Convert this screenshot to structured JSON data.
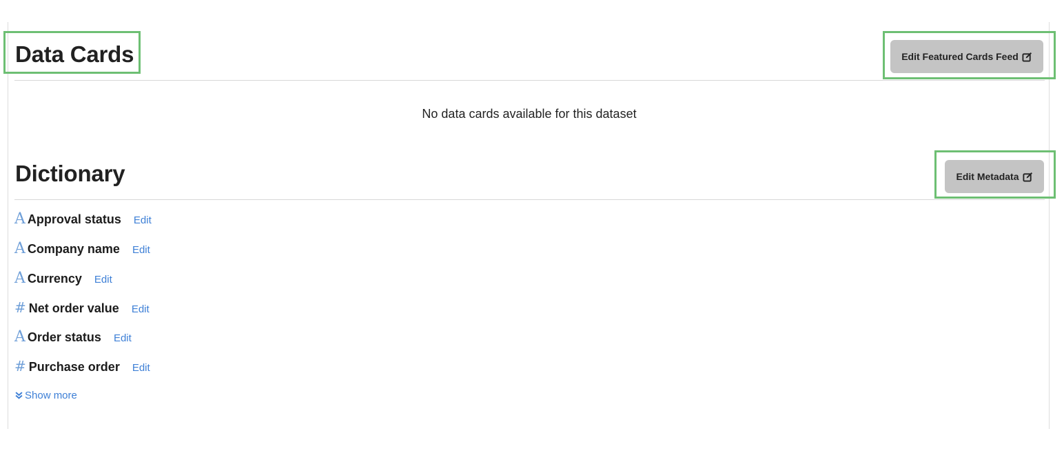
{
  "data_cards": {
    "title": "Data Cards",
    "edit_button_label": "Edit Featured Cards Feed",
    "empty_message": "No data cards available for this dataset"
  },
  "dictionary": {
    "title": "Dictionary",
    "edit_button_label": "Edit Metadata",
    "fields": [
      {
        "type_icon": "A",
        "name": "Approval status",
        "edit_label": "Edit"
      },
      {
        "type_icon": "A",
        "name": "Company name",
        "edit_label": "Edit"
      },
      {
        "type_icon": "A",
        "name": "Currency",
        "edit_label": "Edit"
      },
      {
        "type_icon": "#",
        "name": "Net order value",
        "edit_label": "Edit"
      },
      {
        "type_icon": "A",
        "name": "Order status",
        "edit_label": "Edit"
      },
      {
        "type_icon": "#",
        "name": "Purchase order",
        "edit_label": "Edit"
      }
    ],
    "show_more_label": "Show more"
  },
  "colors": {
    "highlight": "#6dbf73",
    "link": "#3d7fd6",
    "type_icon": "#6f9fd8",
    "button_bg": "#c4c4c4"
  }
}
